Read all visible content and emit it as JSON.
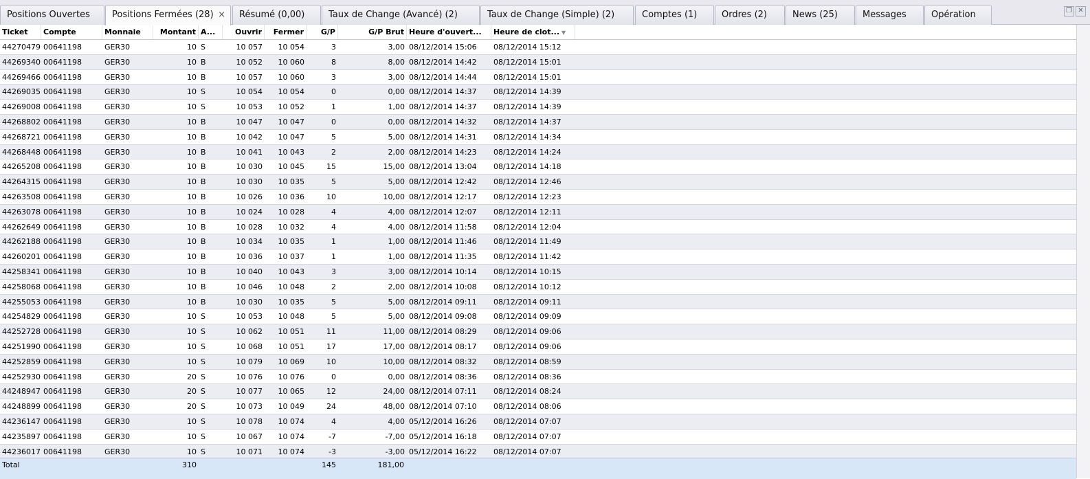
{
  "tabs": [
    {
      "label": "Positions Ouvertes",
      "active": false
    },
    {
      "label": "Positions Fermées (28)",
      "active": true,
      "closable": true
    },
    {
      "label": "Résumé (0,00)",
      "active": false
    },
    {
      "label": "Taux de Change (Avancé) (2)",
      "active": false
    },
    {
      "label": "Taux de Change (Simple) (2)",
      "active": false
    },
    {
      "label": "Comptes (1)",
      "active": false
    },
    {
      "label": "Ordres (2)",
      "active": false
    },
    {
      "label": "News (25)",
      "active": false
    },
    {
      "label": "Messages",
      "active": false
    },
    {
      "label": "Opération",
      "active": false
    }
  ],
  "window_buttons": {
    "restore_icon": "restore-icon",
    "close_icon": "close-icon",
    "close_glyph": "✕",
    "restore_glyph": "❐",
    "tab_close_glyph": "×"
  },
  "columns": [
    {
      "key": "ticket",
      "label": "Ticket",
      "align": "left"
    },
    {
      "key": "compte",
      "label": "Compte",
      "align": "left"
    },
    {
      "key": "monnaie",
      "label": "Monnaie",
      "align": "left"
    },
    {
      "key": "montant",
      "label": "Montant",
      "align": "right"
    },
    {
      "key": "action",
      "label": "A...",
      "align": "left"
    },
    {
      "key": "ouvrir",
      "label": "Ouvrir",
      "align": "right"
    },
    {
      "key": "fermer",
      "label": "Fermer",
      "align": "right"
    },
    {
      "key": "gp",
      "label": "G/P",
      "align": "right"
    },
    {
      "key": "gp_brut",
      "label": "G/P Brut",
      "align": "right"
    },
    {
      "key": "heure_ouverture",
      "label": "Heure d'ouvert...",
      "align": "left"
    },
    {
      "key": "heure_cloture",
      "label": "Heure de clot...",
      "align": "left",
      "sorted": true
    }
  ],
  "rows": [
    [
      "44270479",
      "00641198",
      "GER30",
      "10",
      "S",
      "10 057",
      "10 054",
      "3",
      "3,00",
      "08/12/2014 15:06",
      "08/12/2014 15:12"
    ],
    [
      "44269340",
      "00641198",
      "GER30",
      "10",
      "B",
      "10 052",
      "10 060",
      "8",
      "8,00",
      "08/12/2014 14:42",
      "08/12/2014 15:01"
    ],
    [
      "44269466",
      "00641198",
      "GER30",
      "10",
      "B",
      "10 057",
      "10 060",
      "3",
      "3,00",
      "08/12/2014 14:44",
      "08/12/2014 15:01"
    ],
    [
      "44269035",
      "00641198",
      "GER30",
      "10",
      "S",
      "10 054",
      "10 054",
      "0",
      "0,00",
      "08/12/2014 14:37",
      "08/12/2014 14:39"
    ],
    [
      "44269008",
      "00641198",
      "GER30",
      "10",
      "S",
      "10 053",
      "10 052",
      "1",
      "1,00",
      "08/12/2014 14:37",
      "08/12/2014 14:39"
    ],
    [
      "44268802",
      "00641198",
      "GER30",
      "10",
      "B",
      "10 047",
      "10 047",
      "0",
      "0,00",
      "08/12/2014 14:32",
      "08/12/2014 14:37"
    ],
    [
      "44268721",
      "00641198",
      "GER30",
      "10",
      "B",
      "10 042",
      "10 047",
      "5",
      "5,00",
      "08/12/2014 14:31",
      "08/12/2014 14:34"
    ],
    [
      "44268448",
      "00641198",
      "GER30",
      "10",
      "B",
      "10 041",
      "10 043",
      "2",
      "2,00",
      "08/12/2014 14:23",
      "08/12/2014 14:24"
    ],
    [
      "44265208",
      "00641198",
      "GER30",
      "10",
      "B",
      "10 030",
      "10 045",
      "15",
      "15,00",
      "08/12/2014 13:04",
      "08/12/2014 14:18"
    ],
    [
      "44264315",
      "00641198",
      "GER30",
      "10",
      "B",
      "10 030",
      "10 035",
      "5",
      "5,00",
      "08/12/2014 12:42",
      "08/12/2014 12:46"
    ],
    [
      "44263508",
      "00641198",
      "GER30",
      "10",
      "B",
      "10 026",
      "10 036",
      "10",
      "10,00",
      "08/12/2014 12:17",
      "08/12/2014 12:23"
    ],
    [
      "44263078",
      "00641198",
      "GER30",
      "10",
      "B",
      "10 024",
      "10 028",
      "4",
      "4,00",
      "08/12/2014 12:07",
      "08/12/2014 12:11"
    ],
    [
      "44262649",
      "00641198",
      "GER30",
      "10",
      "B",
      "10 028",
      "10 032",
      "4",
      "4,00",
      "08/12/2014 11:58",
      "08/12/2014 12:04"
    ],
    [
      "44262188",
      "00641198",
      "GER30",
      "10",
      "B",
      "10 034",
      "10 035",
      "1",
      "1,00",
      "08/12/2014 11:46",
      "08/12/2014 11:49"
    ],
    [
      "44260201",
      "00641198",
      "GER30",
      "10",
      "B",
      "10 036",
      "10 037",
      "1",
      "1,00",
      "08/12/2014 11:35",
      "08/12/2014 11:42"
    ],
    [
      "44258341",
      "00641198",
      "GER30",
      "10",
      "B",
      "10 040",
      "10 043",
      "3",
      "3,00",
      "08/12/2014 10:14",
      "08/12/2014 10:15"
    ],
    [
      "44258068",
      "00641198",
      "GER30",
      "10",
      "B",
      "10 046",
      "10 048",
      "2",
      "2,00",
      "08/12/2014 10:08",
      "08/12/2014 10:12"
    ],
    [
      "44255053",
      "00641198",
      "GER30",
      "10",
      "B",
      "10 030",
      "10 035",
      "5",
      "5,00",
      "08/12/2014 09:11",
      "08/12/2014 09:11"
    ],
    [
      "44254829",
      "00641198",
      "GER30",
      "10",
      "S",
      "10 053",
      "10 048",
      "5",
      "5,00",
      "08/12/2014 09:08",
      "08/12/2014 09:09"
    ],
    [
      "44252728",
      "00641198",
      "GER30",
      "10",
      "S",
      "10 062",
      "10 051",
      "11",
      "11,00",
      "08/12/2014 08:29",
      "08/12/2014 09:06"
    ],
    [
      "44251990",
      "00641198",
      "GER30",
      "10",
      "S",
      "10 068",
      "10 051",
      "17",
      "17,00",
      "08/12/2014 08:17",
      "08/12/2014 09:06"
    ],
    [
      "44252859",
      "00641198",
      "GER30",
      "10",
      "S",
      "10 079",
      "10 069",
      "10",
      "10,00",
      "08/12/2014 08:32",
      "08/12/2014 08:59"
    ],
    [
      "44252930",
      "00641198",
      "GER30",
      "20",
      "S",
      "10 076",
      "10 076",
      "0",
      "0,00",
      "08/12/2014 08:36",
      "08/12/2014 08:36"
    ],
    [
      "44248947",
      "00641198",
      "GER30",
      "20",
      "S",
      "10 077",
      "10 065",
      "12",
      "24,00",
      "08/12/2014 07:11",
      "08/12/2014 08:24"
    ],
    [
      "44248899",
      "00641198",
      "GER30",
      "20",
      "S",
      "10 073",
      "10 049",
      "24",
      "48,00",
      "08/12/2014 07:10",
      "08/12/2014 08:06"
    ],
    [
      "44236147",
      "00641198",
      "GER30",
      "10",
      "S",
      "10 078",
      "10 074",
      "4",
      "4,00",
      "05/12/2014 16:26",
      "08/12/2014 07:07"
    ],
    [
      "44235897",
      "00641198",
      "GER30",
      "10",
      "S",
      "10 067",
      "10 074",
      "-7",
      "-7,00",
      "05/12/2014 16:18",
      "08/12/2014 07:07"
    ],
    [
      "44236017",
      "00641198",
      "GER30",
      "10",
      "S",
      "10 071",
      "10 074",
      "-3",
      "-3,00",
      "05/12/2014 16:22",
      "08/12/2014 07:07"
    ]
  ],
  "totals": {
    "label": "Total",
    "montant": "310",
    "gp": "145",
    "gp_brut": "181,00"
  }
}
